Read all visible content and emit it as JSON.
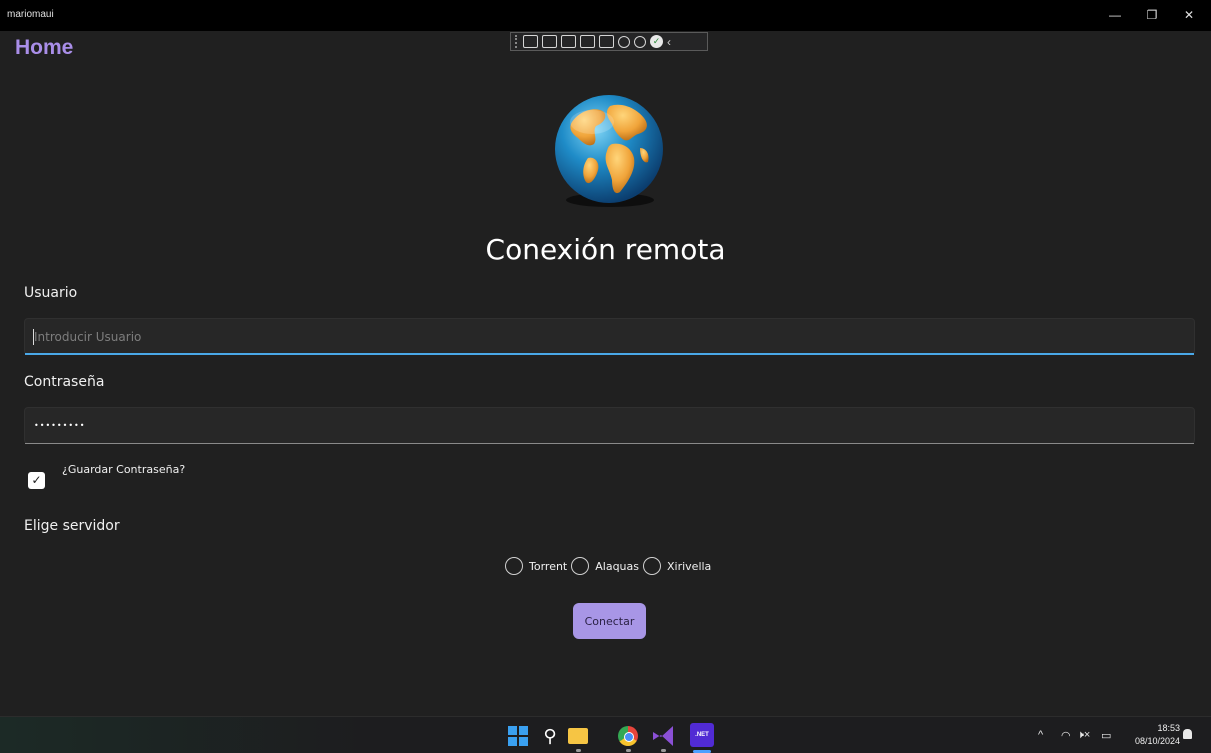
{
  "window": {
    "app_name": "mariomaui",
    "minimize_glyph": "—",
    "restore_glyph": "❐",
    "close_glyph": "✕"
  },
  "debug_toolbar": {
    "icons": [
      "live-visual-tree-icon",
      "camera-icon",
      "select-element-icon",
      "display-layout-adorners-icon",
      "track-focus-icon",
      "binding-failures-icon",
      "accessibility-icon",
      "hot-reload-status-icon"
    ],
    "collapse_glyph": "‹",
    "status_check_glyph": "✓"
  },
  "page": {
    "title": "Home",
    "heading": "Conexión remota",
    "globe_icon": "globe-icon"
  },
  "form": {
    "username": {
      "label": "Usuario",
      "placeholder": "Introducir Usuario",
      "value": ""
    },
    "password": {
      "label": "Contraseña",
      "value": "•••••••••"
    },
    "remember": {
      "label": "¿Guardar Contraseña?",
      "checked": true,
      "check_glyph": "✓"
    },
    "server": {
      "label": "Elige servidor",
      "options": [
        "Torrent",
        "Alaquas",
        "Xirivella"
      ],
      "selected": null
    },
    "submit_label": "Conectar"
  },
  "taskbar": {
    "apps": [
      "start-icon",
      "search-icon",
      "file-explorer-icon",
      "chrome-icon",
      "visual-studio-icon",
      "dotnet-app-icon"
    ],
    "search_glyph": "⚲",
    "dotnet_label": ".NET",
    "tray": {
      "chevron": "^",
      "wifi": "◠",
      "volume": "🕨×",
      "battery": "▭"
    },
    "time": "18:53",
    "date": "08/10/2024"
  },
  "colors": {
    "accent": "#a98ee8",
    "button_bg": "#a896e6",
    "focus_underline": "#4aa8e8",
    "background": "#202020"
  }
}
